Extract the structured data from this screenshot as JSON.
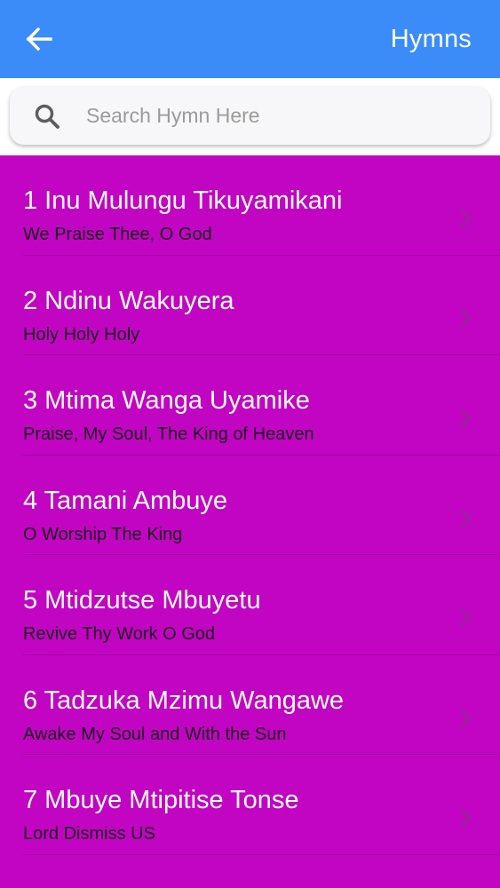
{
  "header": {
    "title": "Hymns",
    "back_icon": "arrow-left-icon",
    "background_color": "#3b8cf8"
  },
  "search": {
    "placeholder": "Search Hymn Here",
    "value": "",
    "icon": "search-icon"
  },
  "list": {
    "background_color": "#c105c2",
    "items": [
      {
        "title": "1 Inu Mulungu Tikuyamikani",
        "subtitle": "We Praise Thee, O God"
      },
      {
        "title": "2 Ndinu Wakuyera",
        "subtitle": "Holy Holy Holy"
      },
      {
        "title": "3 Mtima Wanga Uyamike",
        "subtitle": "Praise, My Soul, The King of Heaven"
      },
      {
        "title": "4 Tamani Ambuye",
        "subtitle": "O Worship The King"
      },
      {
        "title": "5 Mtidzutse Mbuyetu",
        "subtitle": "Revive Thy Work O God"
      },
      {
        "title": "6 Tadzuka Mzimu Wangawe",
        "subtitle": "Awake My Soul and With the Sun"
      },
      {
        "title": "7 Mbuye Mtipitise Tonse",
        "subtitle": "Lord Dismiss US"
      }
    ]
  }
}
